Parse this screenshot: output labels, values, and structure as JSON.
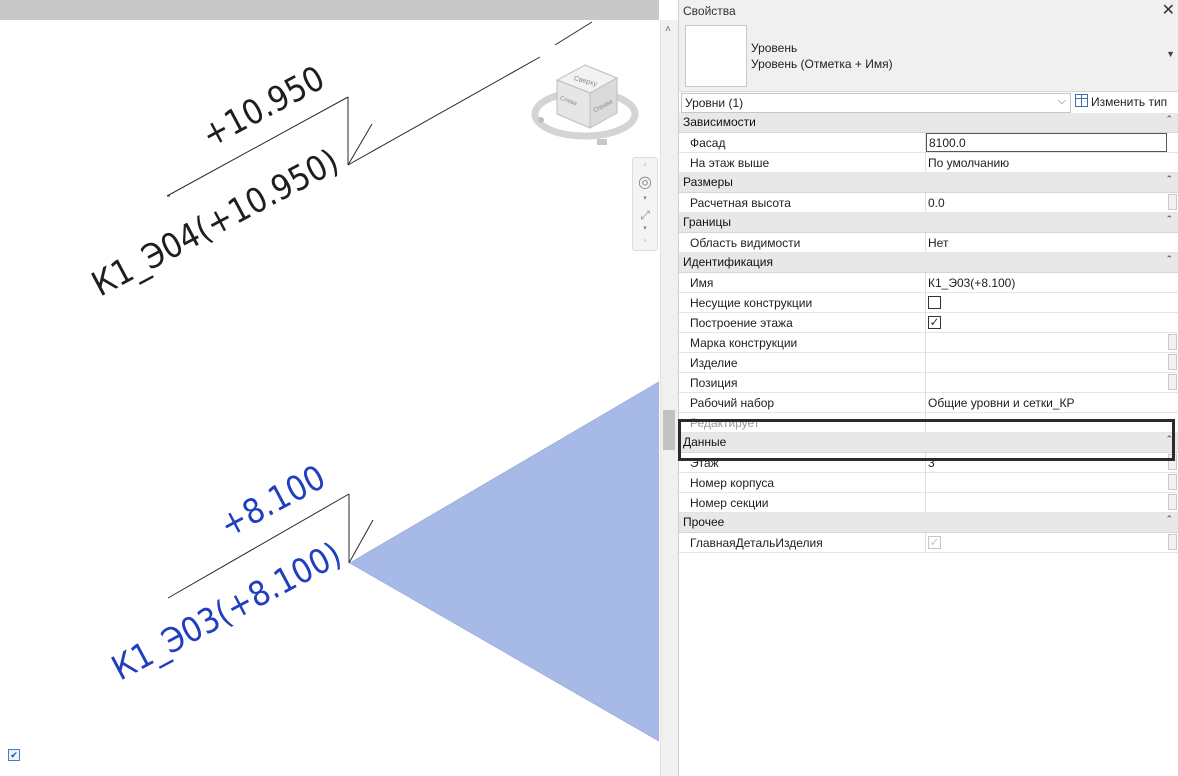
{
  "viewport": {
    "levels": [
      {
        "elevation": "+10.950",
        "name": "К1_Э04(+10.950)",
        "color": "#1e1e1e"
      },
      {
        "elevation": "+8.100",
        "name": "К1_Э03(+8.100)",
        "color": "#1f3fbf"
      }
    ],
    "floor_fill": "#a7b9e6",
    "viewcube": {
      "top": "Сверху",
      "left": "Слева",
      "right": "Справа"
    }
  },
  "properties": {
    "title": "Свойства",
    "close": "✕",
    "type_line1": "Уровень",
    "type_line2": "Уровень (Отметка + Имя)",
    "filter": "Уровни (1)",
    "edit_type": "Изменить тип",
    "groups": [
      {
        "label": "Зависимости",
        "rows": [
          {
            "name": "Фасад",
            "value": "8100.0"
          },
          {
            "name": "На этаж выше",
            "value": "По умолчанию"
          }
        ]
      },
      {
        "label": "Размеры",
        "rows": [
          {
            "name": "Расчетная высота",
            "value": "0.0"
          }
        ]
      },
      {
        "label": "Границы",
        "rows": [
          {
            "name": "Область видимости",
            "value": "Нет"
          }
        ]
      },
      {
        "label": "Идентификация",
        "rows": [
          {
            "name": "Имя",
            "value": "К1_Э03(+8.100)"
          },
          {
            "name": "Несущие конструкции",
            "value": ""
          },
          {
            "name": "Построение этажа",
            "value": "✓"
          },
          {
            "name": "Марка конструкции",
            "value": ""
          },
          {
            "name": "Изделие",
            "value": ""
          },
          {
            "name": "Позиция",
            "value": ""
          },
          {
            "name": "Рабочий набор",
            "value": "Общие уровни и сетки_КР"
          },
          {
            "name": "Редактирует",
            "value": ""
          }
        ]
      },
      {
        "label": "Данные",
        "rows": [
          {
            "name": "Этаж",
            "value": "3"
          },
          {
            "name": "Номер корпуса",
            "value": ""
          },
          {
            "name": "Номер секции",
            "value": ""
          }
        ]
      },
      {
        "label": "Прочее",
        "rows": [
          {
            "name": "ГлавнаяДетальИзделия",
            "value": "✓"
          }
        ]
      }
    ]
  }
}
